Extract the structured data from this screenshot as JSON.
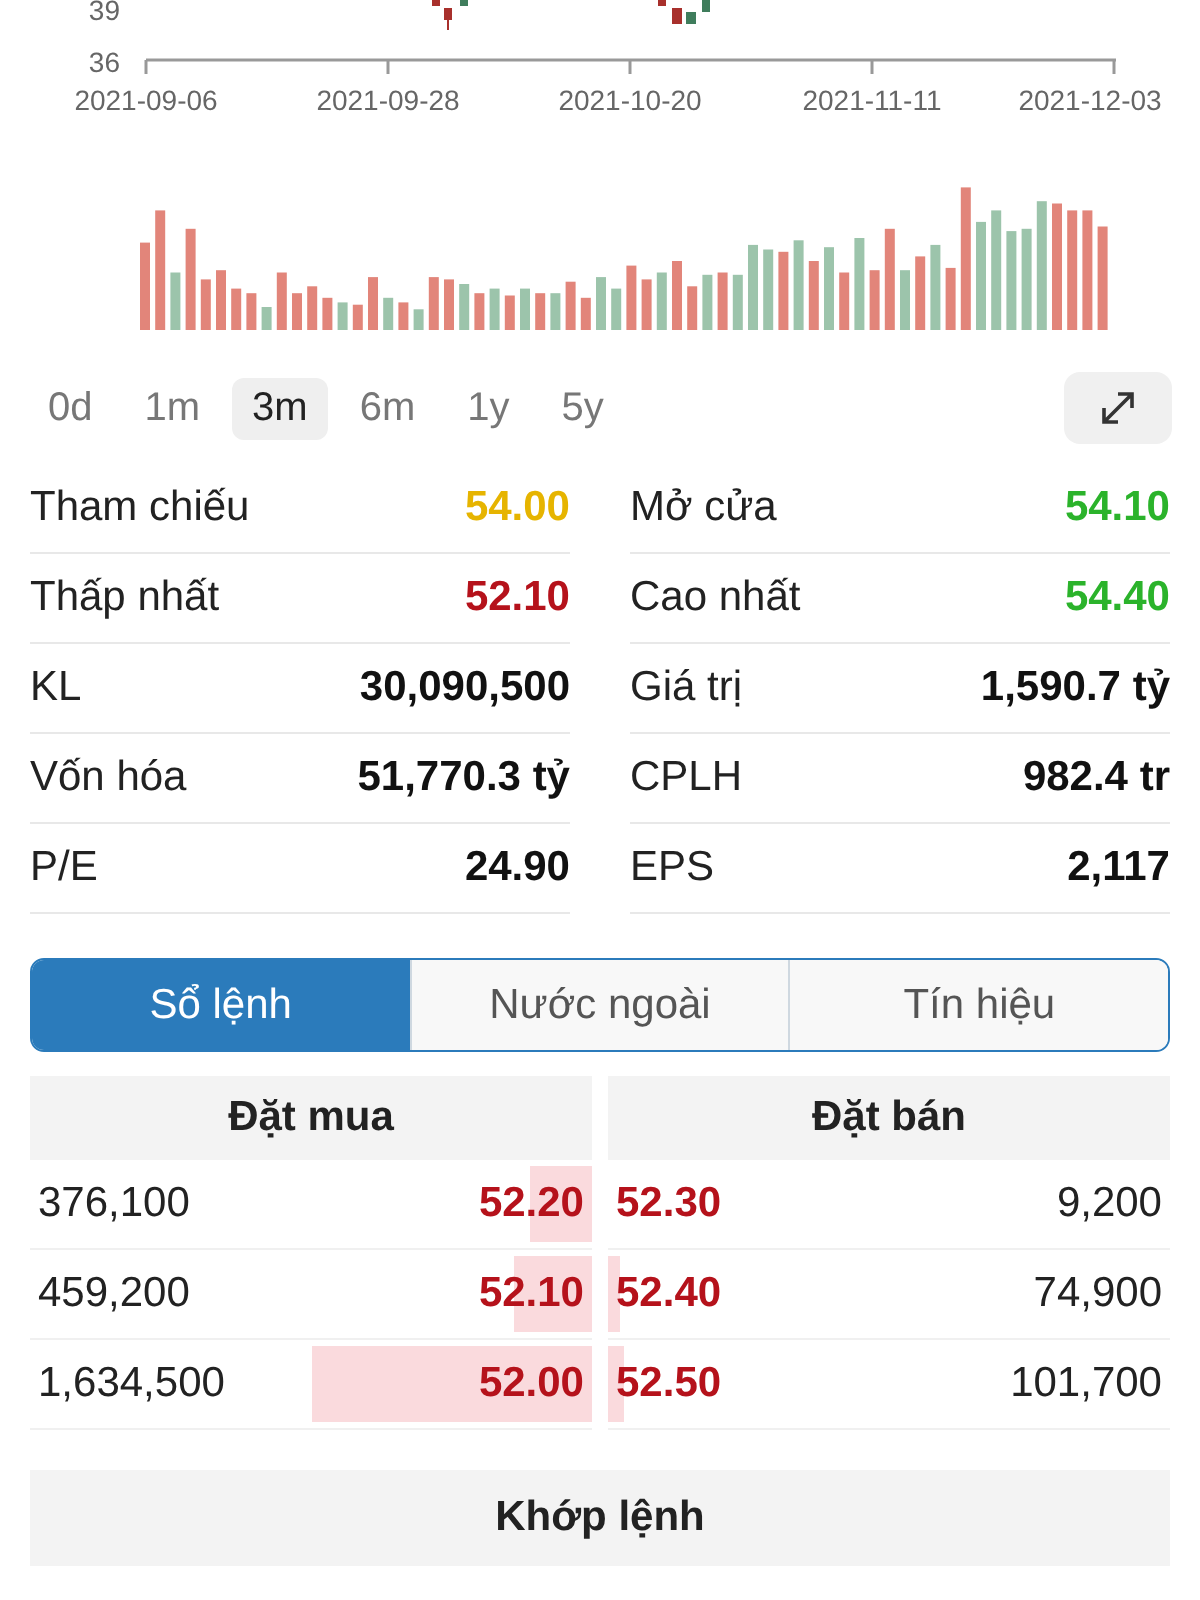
{
  "price_chart": {
    "y_labels": [
      "39",
      "36"
    ],
    "x_labels": [
      "2021-09-06",
      "2021-09-28",
      "2021-10-20",
      "2021-11-11",
      "2021-12-03"
    ]
  },
  "ranges": [
    {
      "label": "0d",
      "selected": false
    },
    {
      "label": "1m",
      "selected": false
    },
    {
      "label": "3m",
      "selected": true
    },
    {
      "label": "6m",
      "selected": false
    },
    {
      "label": "1y",
      "selected": false
    },
    {
      "label": "5y",
      "selected": false
    }
  ],
  "stats_left": [
    {
      "label": "Tham chiếu",
      "value": "54.00",
      "color": "#e6b400"
    },
    {
      "label": "Thấp nhất",
      "value": "52.10",
      "color": "#b5121b"
    },
    {
      "label": "KL",
      "value": "30,090,500",
      "color": "#111111"
    },
    {
      "label": "Vốn hóa",
      "value": "51,770.3 tỷ",
      "color": "#111111"
    },
    {
      "label": "P/E",
      "value": "24.90",
      "color": "#111111"
    }
  ],
  "stats_right": [
    {
      "label": "Mở cửa",
      "value": "54.10",
      "color": "#2bb32b"
    },
    {
      "label": "Cao nhất",
      "value": "54.40",
      "color": "#2bb32b"
    },
    {
      "label": "Giá trị",
      "value": "1,590.7 tỷ",
      "color": "#111111"
    },
    {
      "label": "CPLH",
      "value": "982.4 tr",
      "color": "#111111"
    },
    {
      "label": "EPS",
      "value": "2,117",
      "color": "#111111"
    }
  ],
  "tabs": [
    {
      "label": "Sổ lệnh",
      "selected": true
    },
    {
      "label": "Nước ngoài",
      "selected": false
    },
    {
      "label": "Tín hiệu",
      "selected": false
    }
  ],
  "order_book": {
    "bid_title": "Đặt mua",
    "ask_title": "Đặt bán",
    "rows": [
      {
        "bid_volume": "376,100",
        "bid_price": "52.20",
        "bid_depth": {
          "level": 0.11
        },
        "ask_price": "52.30",
        "ask_volume": "9,200"
      },
      {
        "bid_volume": "459,200",
        "bid_price": "52.10",
        "bid_depth": {
          "level": 0.14
        },
        "ask_price": "52.40",
        "ask_depth": {
          "level": 0.02
        },
        "ask_volume": "74,900"
      },
      {
        "bid_volume": "1,634,500",
        "bid_price": "52.00",
        "bid_depth": {
          "level": 0.5
        },
        "ask_price": "52.50",
        "ask_depth": {
          "level": 0.03
        },
        "ask_volume": "101,700"
      }
    ]
  },
  "matched_title": "Khớp lệnh"
}
